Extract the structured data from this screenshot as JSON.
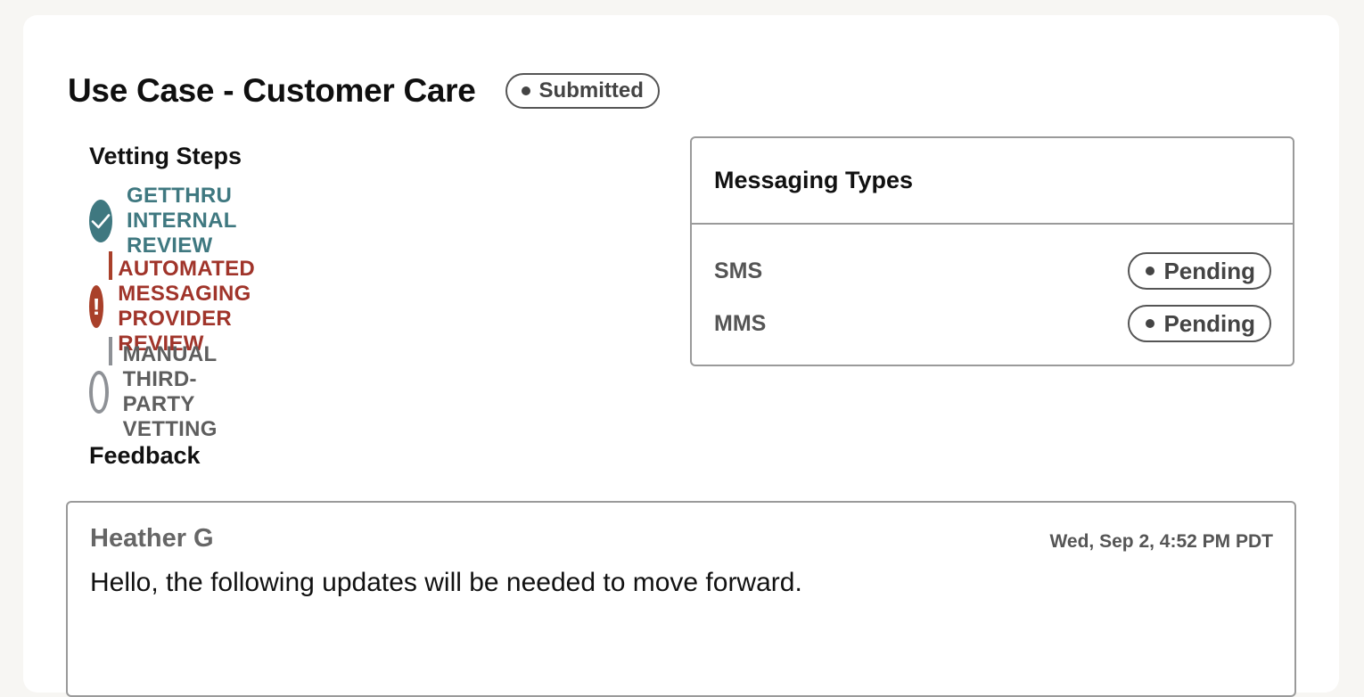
{
  "use_case": {
    "title": "Use Case - Customer Care",
    "status": "Submitted"
  },
  "vetting": {
    "heading": "Vetting Steps",
    "steps": [
      {
        "label": "GETTHRU INTERNAL REVIEW",
        "state": "complete",
        "icon": "check-icon",
        "color": "#3f7880"
      },
      {
        "label": "AUTOMATED MESSAGING PROVIDER REVIEW",
        "state": "error",
        "icon": "exclamation-icon",
        "color": "#a9402a"
      },
      {
        "label": "MANUAL THIRD-PARTY VETTING",
        "state": "pending",
        "icon": "empty-circle-icon",
        "color": "#8e9196"
      }
    ]
  },
  "messaging_types": {
    "heading": "Messaging Types",
    "items": [
      {
        "type": "SMS",
        "status": "Pending"
      },
      {
        "type": "MMS",
        "status": "Pending"
      }
    ]
  },
  "feedback": {
    "heading": "Feedback",
    "entries": [
      {
        "author": "Heather G",
        "timestamp": "Wed, Sep 2, 4:52 PM PDT",
        "message": "Hello, the following updates will be needed to move forward."
      }
    ]
  },
  "colors": {
    "complete": "#3f7880",
    "error": "#a9402a",
    "pending": "#8e9196",
    "background": "#f7f6f3"
  }
}
